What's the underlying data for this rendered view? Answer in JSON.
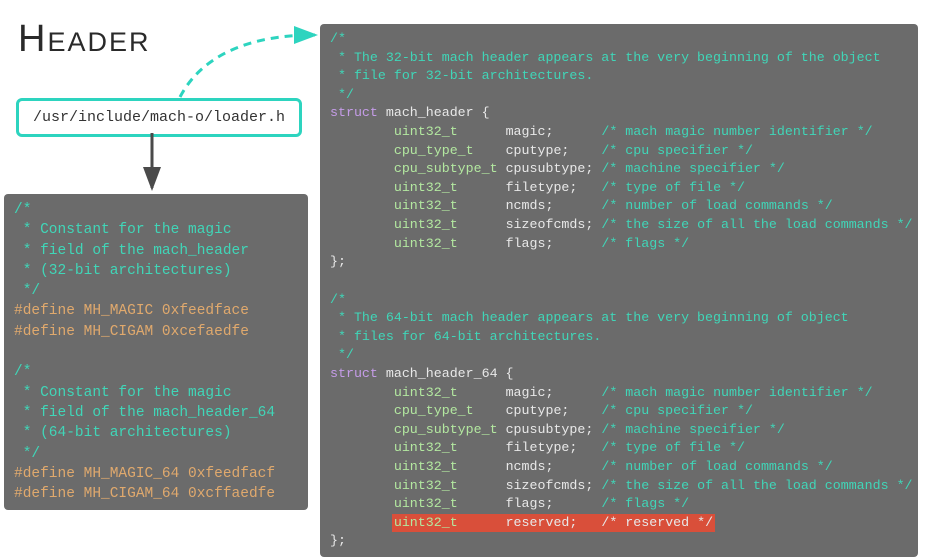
{
  "title": "Header",
  "path": "/usr/include/mach-o/loader.h",
  "left_block": {
    "c32_1": "/*",
    "c32_2": " * Constant for the magic",
    "c32_3": " * field of the mach_header",
    "c32_4": " * (32-bit architectures)",
    "c32_5": " */",
    "def_mh_magic": "#define MH_MAGIC 0xfeedface",
    "def_mh_cigam": "#define MH_CIGAM 0xcefaedfe",
    "c64_1": "/*",
    "c64_2": " * Constant for the magic",
    "c64_3": " * field of the mach_header_64",
    "c64_4": " * (64-bit architectures)",
    "c64_5": " */",
    "def_mh_magic64": "#define MH_MAGIC_64 0xfeedfacf",
    "def_mh_cigam64": "#define MH_CIGAM_64 0xcffaedfe"
  },
  "right_block": {
    "hdr32_c1": "/*",
    "hdr32_c2": " * The 32-bit mach header appears at the very beginning of the object",
    "hdr32_c3": " * file for 32-bit architectures.",
    "hdr32_c4": " */",
    "struct_kw": "struct",
    "hdr32_name": " mach_header {",
    "t_u32": "uint32_t",
    "t_cpu": "cpu_type_t",
    "t_cpusub": "cpu_subtype_t",
    "f_magic": "magic;",
    "f_cputype": "cputype;",
    "f_cpusub": "cpusubtype;",
    "f_filetype": "filetype;",
    "f_ncmds": "ncmds;",
    "f_sizeofcmds": "sizeofcmds;",
    "f_flags": "flags;",
    "f_reserved": "reserved;",
    "cm_magic": "/* mach magic number identifier */",
    "cm_cpu": "/* cpu specifier */",
    "cm_cpusub": "/* machine specifier */",
    "cm_filetype": "/* type of file */",
    "cm_ncmds": "/* number of load commands */",
    "cm_sizeofcmds": "/* the size of all the load commands */",
    "cm_flags": "/* flags */",
    "cm_reserved": "/* reserved */",
    "close": "};",
    "hdr64_c1": "/*",
    "hdr64_c2": " * The 64-bit mach header appears at the very beginning of object",
    "hdr64_c3": " * files for 64-bit architectures.",
    "hdr64_c4": " */",
    "hdr64_name": " mach_header_64 {"
  }
}
